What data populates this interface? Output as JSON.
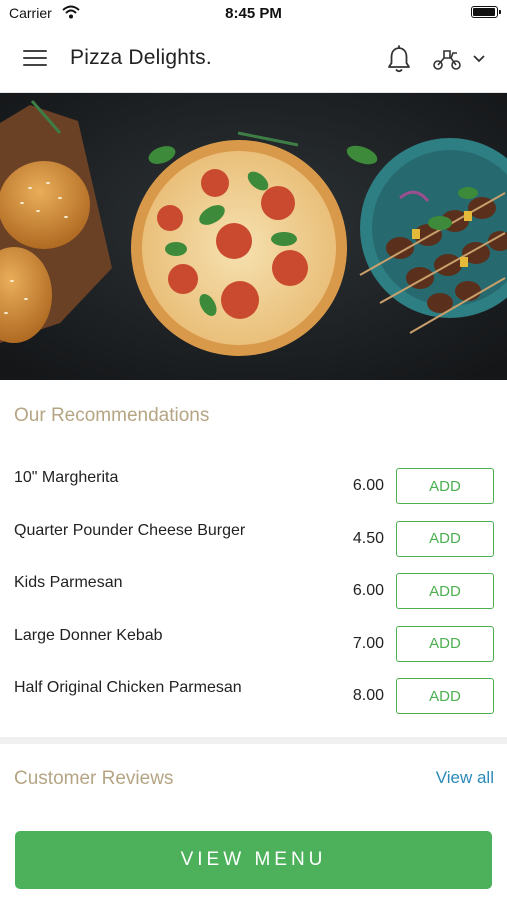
{
  "status_bar": {
    "carrier": "Carrier",
    "time": "8:45 PM"
  },
  "header": {
    "title": "Pizza Delights.",
    "icons": [
      "menu-icon",
      "bell-icon",
      "delivery-icon",
      "chevron-down-icon"
    ]
  },
  "recommendations": {
    "title": "Our Recommendations",
    "items": [
      {
        "name": "10\" Margherita",
        "price": "6.00",
        "button": "ADD"
      },
      {
        "name": "Quarter Pounder Cheese Burger",
        "price": "4.50",
        "button": "ADD"
      },
      {
        "name": "Kids Parmesan",
        "price": "6.00",
        "button": "ADD"
      },
      {
        "name": "Large Donner Kebab",
        "price": "7.00",
        "button": "ADD"
      },
      {
        "name": "Half Original Chicken Parmesan",
        "price": "8.00",
        "button": "ADD"
      }
    ]
  },
  "reviews": {
    "title": "Customer Reviews",
    "view_all": "View all"
  },
  "footer": {
    "view_menu": "VIEW MENU"
  },
  "colors": {
    "accent_green": "#4cb15a",
    "section_title": "#b5a584",
    "link_blue": "#2a8ab8"
  }
}
